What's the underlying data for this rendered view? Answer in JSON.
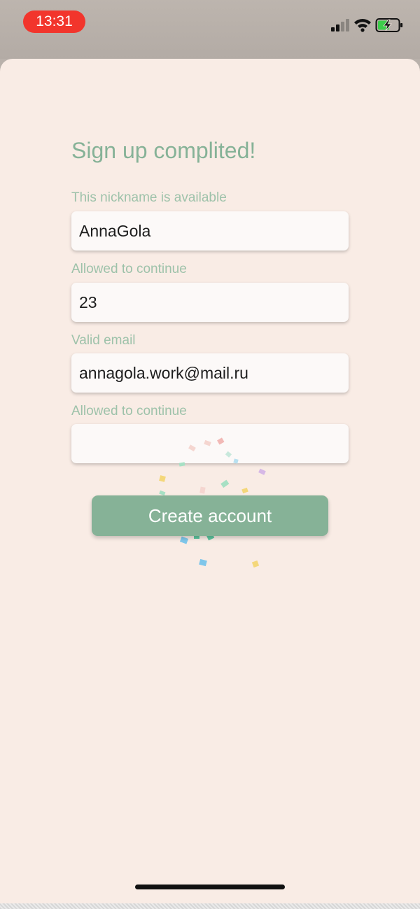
{
  "status_bar": {
    "time": "13:31",
    "icons": [
      "signal-icon",
      "wifi-icon",
      "battery-charging-icon"
    ],
    "time_pill_color": "#f2352c"
  },
  "signup": {
    "title": "Sign up complited!",
    "fields": [
      {
        "label": "This nickname is available",
        "value": "AnnaGola",
        "placeholder": ""
      },
      {
        "label": "Allowed to continue",
        "value": "23",
        "placeholder": ""
      },
      {
        "label": "Valid email",
        "value": "annagola.work@mail.ru",
        "placeholder": ""
      },
      {
        "label": "Allowed to continue",
        "value": "",
        "placeholder": ""
      }
    ],
    "create_button_label": "Create account"
  },
  "colors": {
    "accent": "#86b297",
    "label": "#9ec2aa",
    "background": "#f9ece5",
    "field_background": "#fcf9f8"
  }
}
